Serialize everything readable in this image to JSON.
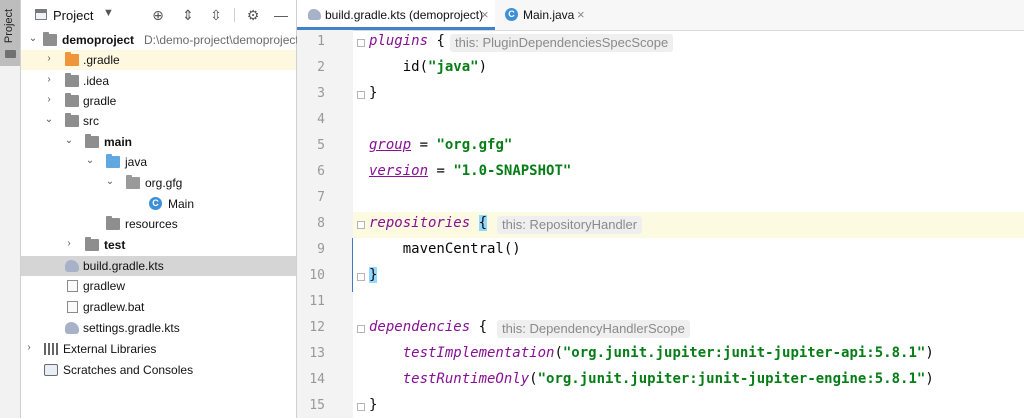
{
  "stripe": {
    "label": "Project"
  },
  "project_panel": {
    "title": "Project",
    "toolbar": [
      "locate-icon",
      "expand-all-icon",
      "collapse-all-icon",
      "gear-icon",
      "hide-icon"
    ],
    "tree": [
      {
        "label": "demoproject",
        "path": "D:\\demo-project\\demoproject",
        "bold": true,
        "expanded": true,
        "icon": "folder-icon"
      },
      {
        "label": ".gradle",
        "expanded": false,
        "icon": "folder-orange-icon"
      },
      {
        "label": ".idea",
        "expanded": false,
        "icon": "folder-icon"
      },
      {
        "label": "gradle",
        "expanded": false,
        "icon": "folder-icon"
      },
      {
        "label": "src",
        "expanded": true,
        "icon": "folder-icon"
      },
      {
        "label": "main",
        "bold": true,
        "expanded": true,
        "icon": "folder-icon"
      },
      {
        "label": "java",
        "expanded": true,
        "icon": "folder-blue-icon"
      },
      {
        "label": "org.gfg",
        "expanded": true,
        "icon": "package-icon"
      },
      {
        "label": "Main",
        "icon": "java-class-icon"
      },
      {
        "label": "resources",
        "icon": "resources-folder-icon"
      },
      {
        "label": "test",
        "bold": true,
        "expanded": false,
        "icon": "folder-icon"
      },
      {
        "label": "build.gradle.kts",
        "icon": "gradle-icon",
        "selected": true
      },
      {
        "label": "gradlew",
        "icon": "file-icon"
      },
      {
        "label": "gradlew.bat",
        "icon": "file-icon"
      },
      {
        "label": "settings.gradle.kts",
        "icon": "gradle-icon"
      },
      {
        "label": "External Libraries",
        "expanded": false,
        "icon": "libraries-icon"
      },
      {
        "label": "Scratches and Consoles",
        "icon": "scratches-icon"
      }
    ]
  },
  "editor": {
    "tabs": [
      {
        "label": "build.gradle.kts (demoproject)",
        "active": true,
        "close": "×"
      },
      {
        "label": "Main.java",
        "active": false,
        "close": "×"
      }
    ],
    "line_numbers": [
      "1",
      "2",
      "3",
      "4",
      "5",
      "6",
      "7",
      "8",
      "9",
      "10",
      "11",
      "12",
      "13",
      "14",
      "15"
    ],
    "lines": {
      "l1": {
        "kw": "plugins",
        "brace": " {",
        "hint": "this: PluginDependenciesSpecScope"
      },
      "l2": {
        "pre": "    id(",
        "str": "\"java\"",
        "post": ")"
      },
      "l3": {
        "text": "}"
      },
      "l5": {
        "prop": "group",
        "mid": " = ",
        "str": "\"org.gfg\""
      },
      "l6": {
        "prop": "version",
        "mid": " = ",
        "str": "\"1.0-SNAPSHOT\""
      },
      "l8": {
        "kw": "repositories",
        "space": " ",
        "brace": "{",
        "hint": "this: RepositoryHandler"
      },
      "l9": {
        "text": "    mavenCentral()"
      },
      "l10": {
        "text": "}"
      },
      "l12": {
        "kw": "dependencies",
        "brace": " {",
        "hint": "this: DependencyHandlerScope"
      },
      "l13": {
        "pre": "    ",
        "kw": "testImplementation",
        "open": "(",
        "str": "\"org.junit.jupiter:junit-jupiter-api:5.8.1\"",
        "close": ")"
      },
      "l14": {
        "pre": "    ",
        "kw": "testRuntimeOnly",
        "open": "(",
        "str": "\"org.junit.jupiter:junit-jupiter-engine:5.8.1\"",
        "close": ")"
      },
      "l15": {
        "text": "}"
      }
    }
  },
  "colors": {
    "keyword": "#871094",
    "string": "#067d17",
    "tab_accent": "#4083c9",
    "brace_match": "#93d9ff",
    "current_line": "#fcfae1"
  }
}
